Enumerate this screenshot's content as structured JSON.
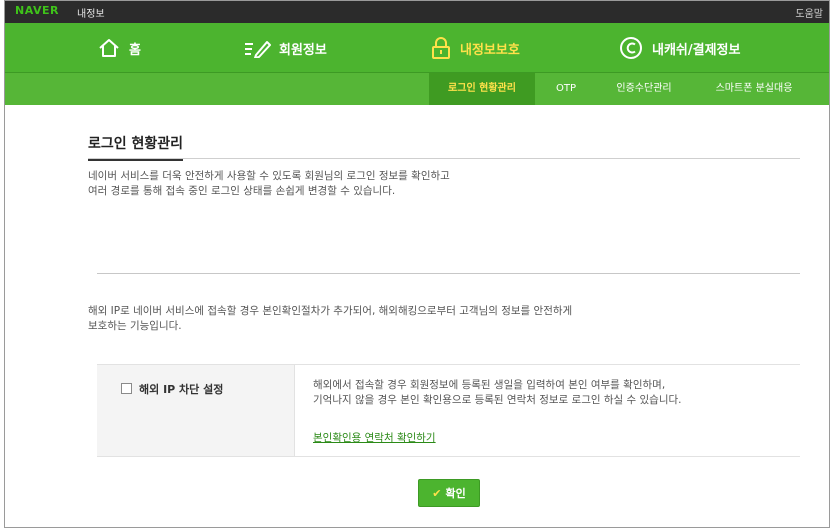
{
  "header": {
    "brand": "NAVER",
    "brand_sub": "내정보",
    "help": "도움말"
  },
  "nav": {
    "items": [
      {
        "label": "홈",
        "icon": "home-icon"
      },
      {
        "label": "회원정보",
        "icon": "pencil-icon"
      },
      {
        "label": "내정보보호",
        "icon": "lock-icon"
      },
      {
        "label": "내캐쉬/결제정보",
        "icon": "copyright-icon"
      }
    ],
    "active_index": 2
  },
  "subnav": {
    "items": [
      "로그인 현황관리",
      "OTP",
      "인증수단관리",
      "스마트폰 분실대응"
    ],
    "active_index": 0
  },
  "main": {
    "title": "로그인 현황관리",
    "desc_line1": "네이버 서비스를 더욱 안전하게 사용할 수 있도록 회원님의 로그인 정보를 확인하고",
    "desc_line2": "여러 경로를 통해 접속 중인 로그인 상태를 손쉽게 변경할 수 있습니다.",
    "overseas_line1": "해외 IP로 네이버 서비스에 접속할 경우 본인확인절차가 추가되어, 해외해킹으로부터 고객님의 정보를 안전하게",
    "overseas_line2": "보호하는 기능입니다.",
    "setting": {
      "label": "해외 IP 차단 설정",
      "checked": false,
      "desc_line1": "해외에서 접속할 경우 회원정보에 등록된 생일을 입력하여 본인 여부를 확인하며,",
      "desc_line2": "기억나지 않을 경우 본인 확인용으로 등록된 연락처 정보로 로그인 하실 수 있습니다.",
      "link": "본인확인용 연락처 확인하기"
    },
    "confirm_label": "확인"
  },
  "colors": {
    "nav_green": "#4cb42f",
    "active_yellow": "#ffe14a",
    "link_green": "#2b8a17"
  }
}
